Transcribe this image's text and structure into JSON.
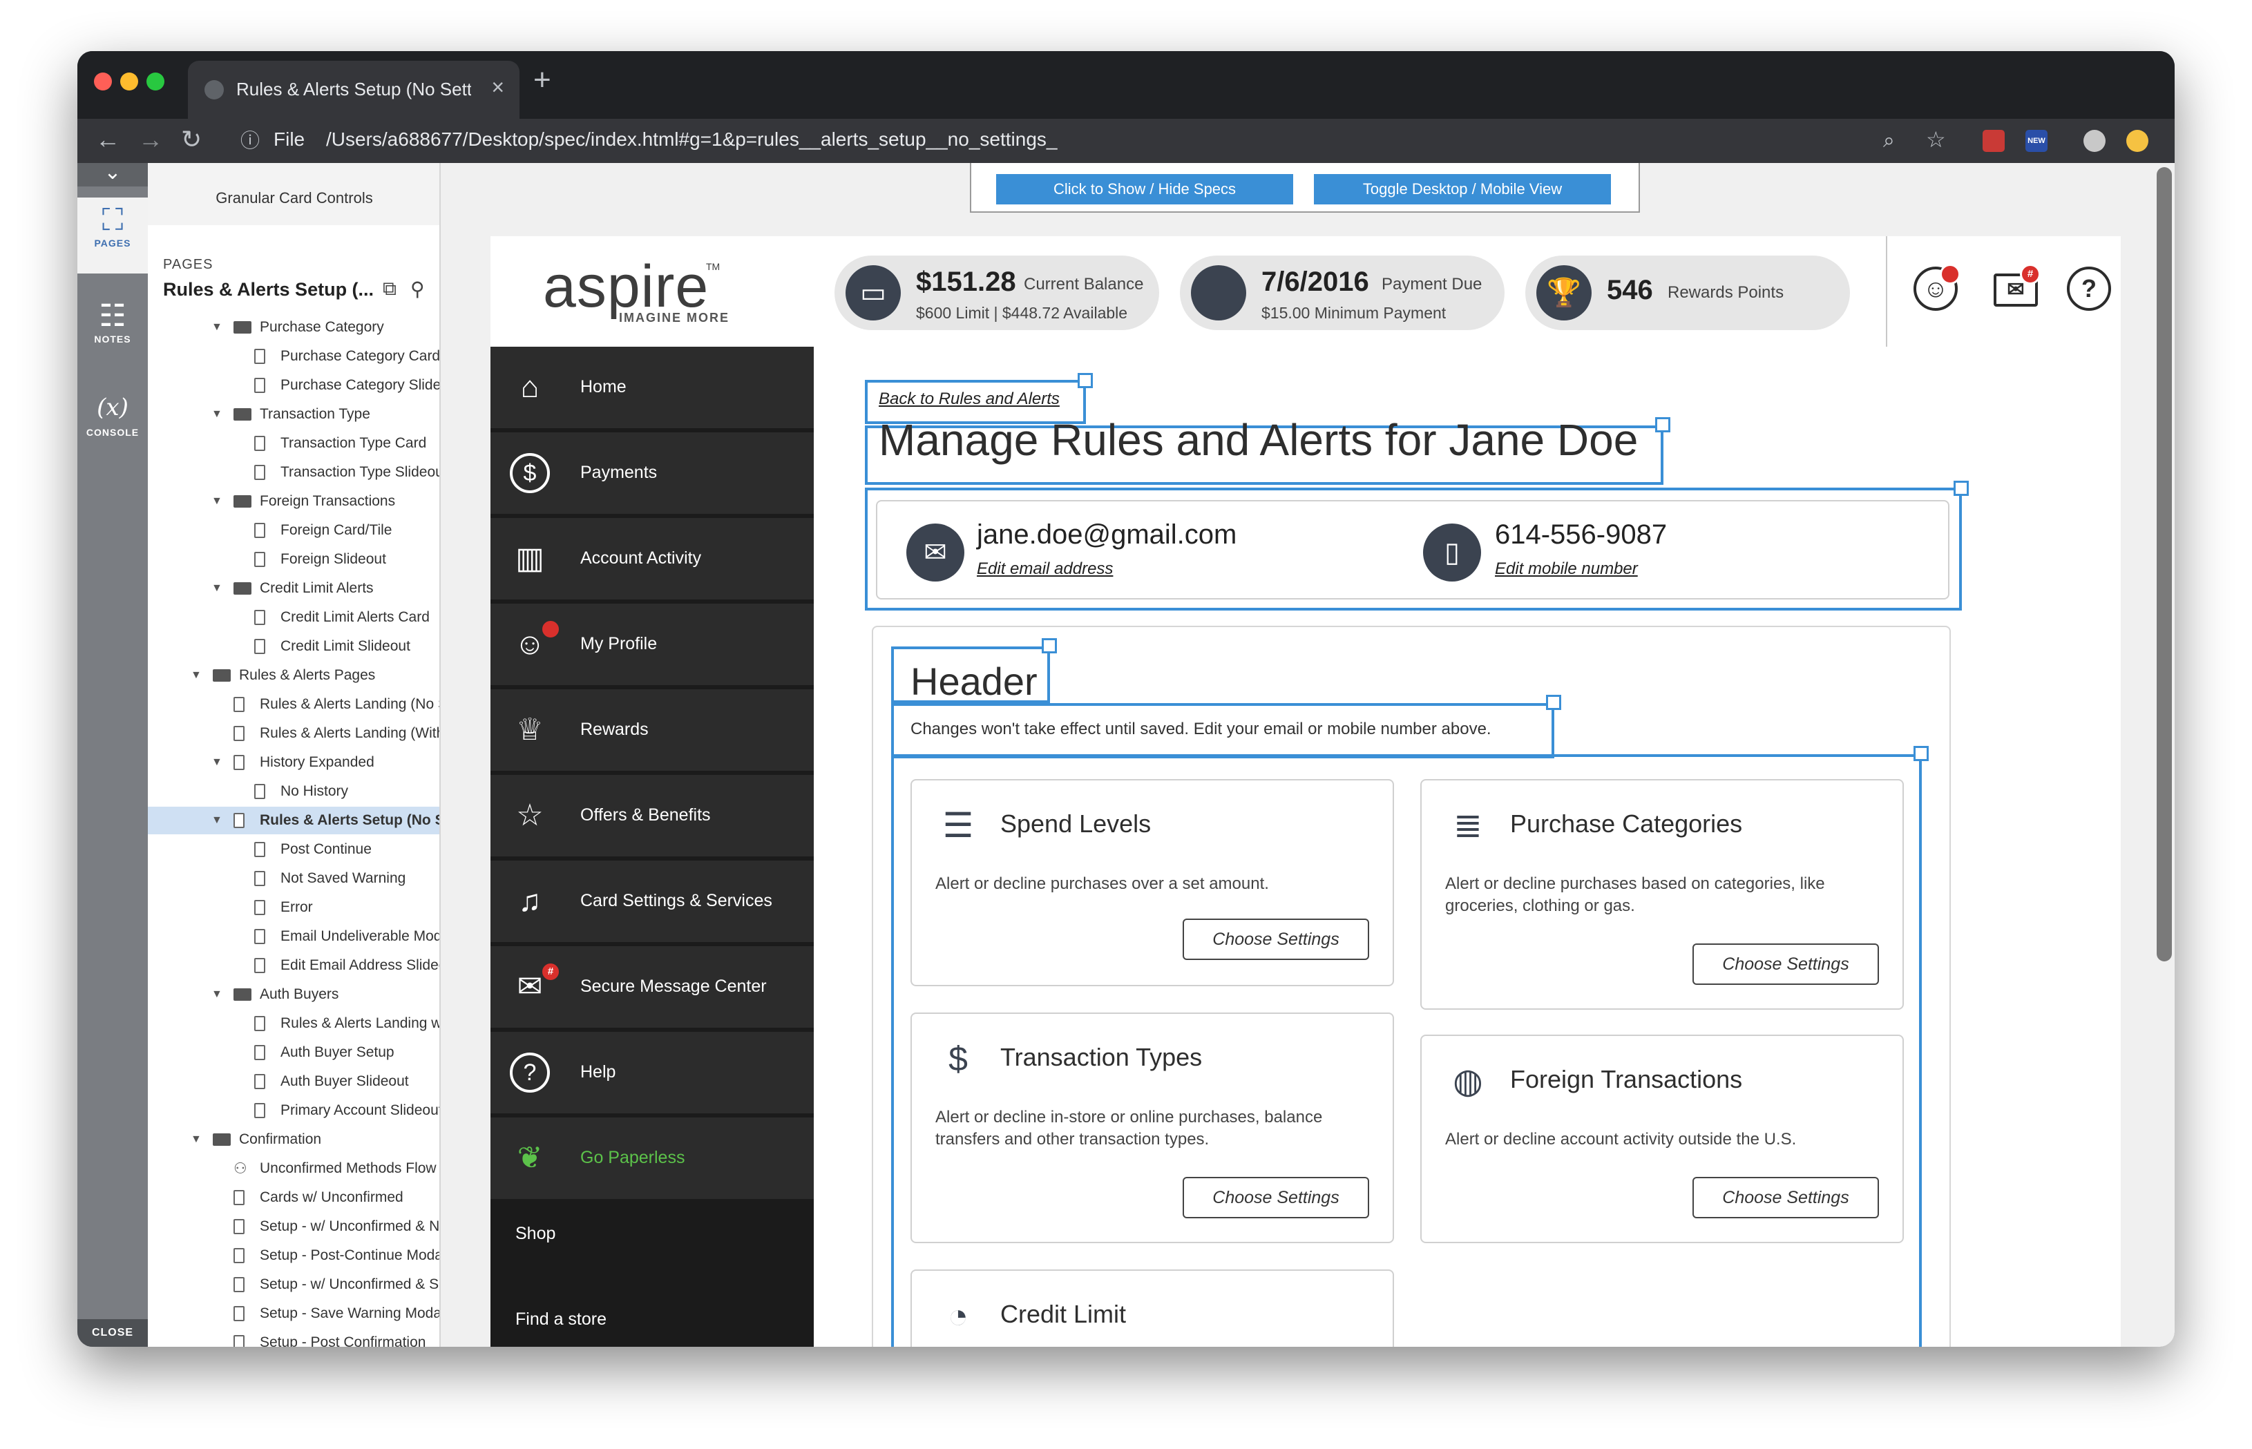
{
  "browser": {
    "tab_title": "Rules & Alerts Setup (No Settin",
    "url_scheme": "File",
    "url": "/Users/a688677/Desktop/spec/index.html#g=1&p=rules__alerts_setup__no_settings_",
    "ext_new_label": "NEW"
  },
  "rail": {
    "pages": "PAGES",
    "notes": "NOTES",
    "console_symbol": "(x)",
    "console": "CONSOLE",
    "close": "CLOSE"
  },
  "tree": {
    "header": "Granular Card Controls",
    "section_label": "PAGES",
    "title": "Rules & Alerts Setup (...",
    "items": [
      {
        "label": "Purchase Category",
        "type": "folder",
        "level": 1,
        "open": true
      },
      {
        "label": "Purchase Category Card",
        "type": "page",
        "level": 2
      },
      {
        "label": "Purchase Category Slideout",
        "type": "page",
        "level": 2
      },
      {
        "label": "Transaction Type",
        "type": "folder",
        "level": 1,
        "open": true
      },
      {
        "label": "Transaction Type Card",
        "type": "page",
        "level": 2
      },
      {
        "label": "Transaction Type Slideout",
        "type": "page",
        "level": 2
      },
      {
        "label": "Foreign Transactions",
        "type": "folder",
        "level": 1,
        "open": true
      },
      {
        "label": "Foreign Card/Tile",
        "type": "page",
        "level": 2
      },
      {
        "label": "Foreign Slideout",
        "type": "page",
        "level": 2
      },
      {
        "label": "Credit Limit Alerts",
        "type": "folder",
        "level": 1,
        "open": true
      },
      {
        "label": "Credit Limit Alerts Card",
        "type": "page",
        "level": 2
      },
      {
        "label": "Credit Limit Slideout",
        "type": "page",
        "level": 2
      },
      {
        "label": "Rules & Alerts Pages",
        "type": "folder",
        "level": 0,
        "open": true
      },
      {
        "label": "Rules & Alerts Landing (No Settings)",
        "type": "page",
        "level": 1
      },
      {
        "label": "Rules & Alerts Landing (With Settings)",
        "type": "page",
        "level": 1
      },
      {
        "label": "History Expanded",
        "type": "page",
        "level": 1,
        "open": true
      },
      {
        "label": "No History",
        "type": "page",
        "level": 2
      },
      {
        "label": "Rules & Alerts Setup (No Settings)",
        "type": "page",
        "level": 1,
        "open": true,
        "selected": true
      },
      {
        "label": "Post Continue",
        "type": "page",
        "level": 2
      },
      {
        "label": "Not Saved Warning",
        "type": "page",
        "level": 2
      },
      {
        "label": "Error",
        "type": "page",
        "level": 2
      },
      {
        "label": "Email Undeliverable Modal",
        "type": "page",
        "level": 2
      },
      {
        "label": "Edit Email Address Slideout",
        "type": "page",
        "level": 2
      },
      {
        "label": "Auth Buyers",
        "type": "folder",
        "level": 1,
        "open": true
      },
      {
        "label": "Rules & Alerts Landing w/ Auth Buyers",
        "type": "page",
        "level": 2
      },
      {
        "label": "Auth Buyer Setup",
        "type": "page",
        "level": 2
      },
      {
        "label": "Auth Buyer Slideout",
        "type": "page",
        "level": 2
      },
      {
        "label": "Primary Account Slideout w/ Auth",
        "type": "page",
        "level": 2
      },
      {
        "label": "Confirmation",
        "type": "folder",
        "level": 0,
        "open": true
      },
      {
        "label": "Unconfirmed Methods Flow",
        "type": "flow",
        "level": 1
      },
      {
        "label": "Cards w/ Unconfirmed",
        "type": "page",
        "level": 1
      },
      {
        "label": "Setup - w/ Unconfirmed & No Settings",
        "type": "page",
        "level": 1
      },
      {
        "label": "Setup - Post-Continue Modal",
        "type": "page",
        "level": 1
      },
      {
        "label": "Setup - w/ Unconfirmed & Settings",
        "type": "page",
        "level": 1
      },
      {
        "label": "Setup - Save Warning Modal",
        "type": "page",
        "level": 1
      },
      {
        "label": "Setup - Post Confirmation",
        "type": "page",
        "level": 1
      }
    ]
  },
  "spec_bar": {
    "show_hide": "Click to Show / Hide Specs",
    "toggle": "Toggle Desktop / Mobile View"
  },
  "header": {
    "logo": "aspire",
    "logo_tm": "TM",
    "logo_tagline": "IMAGINE MORE",
    "balance": {
      "value": "$151.28",
      "label": "Current Balance",
      "sub": "$600 Limit | $448.72 Available"
    },
    "payment": {
      "value": "7/6/2016",
      "label": "Payment Due",
      "sub": "$15.00 Minimum Payment"
    },
    "rewards": {
      "value": "546",
      "label": "Rewards Points"
    },
    "mail_badge": "#",
    "help_symbol": "?"
  },
  "nav": {
    "items": [
      {
        "label": "Home",
        "icon": "home-icon"
      },
      {
        "label": "Payments",
        "icon": "dollar-icon"
      },
      {
        "label": "Account Activity",
        "icon": "bar-chart-icon"
      },
      {
        "label": "My Profile",
        "icon": "profile-icon"
      },
      {
        "label": "Rewards",
        "icon": "trophy-icon"
      },
      {
        "label": "Offers & Benefits",
        "icon": "star-icon"
      },
      {
        "label": "Card Settings & Services",
        "icon": "bell-icon",
        "active": true
      },
      {
        "label": "Secure Message Center",
        "icon": "mail-icon",
        "badge": "#"
      },
      {
        "label": "Help",
        "icon": "help-icon"
      },
      {
        "label": "Go Paperless",
        "icon": "leaf-icon",
        "color": "#5cc24a"
      }
    ],
    "shop": "Shop",
    "find_store": "Find a store"
  },
  "main": {
    "back_link": "Back to Rules and Alerts",
    "title": "Manage Rules and Alerts for Jane Doe",
    "email": "jane.doe@gmail.com",
    "edit_email": "Edit email address",
    "phone": "614-556-9087",
    "edit_phone": "Edit mobile number",
    "section_title": "Header",
    "section_sub": "Changes won't take effect until saved. Edit your email or mobile number above.",
    "cards": [
      {
        "title": "Spend Levels",
        "desc": "Alert or decline purchases over a set amount.",
        "button": "Choose Settings",
        "icon": "sliders-icon"
      },
      {
        "title": "Purchase Categories",
        "desc": "Alert or decline purchases based on categories, like groceries, clothing or gas.",
        "button": "Choose Settings",
        "icon": "list-icon"
      },
      {
        "title": "Transaction Types",
        "desc": "Alert or decline in-store or online purchases, balance transfers and other transaction types.",
        "button": "Choose Settings",
        "icon": "receipt-icon"
      },
      {
        "title": "Foreign Transactions",
        "desc": "Alert or decline account activity outside the U.S.",
        "button": "Choose Settings",
        "icon": "globe-icon"
      },
      {
        "title": "Credit Limit",
        "icon": "gauge-icon"
      }
    ]
  },
  "colors": {
    "spec_blue": "#3a8fd6",
    "nav_bg": "#2c2c2c",
    "paperless_green": "#5cc24a",
    "badge_red": "#d9302c",
    "icon_dark": "#3b4350"
  }
}
